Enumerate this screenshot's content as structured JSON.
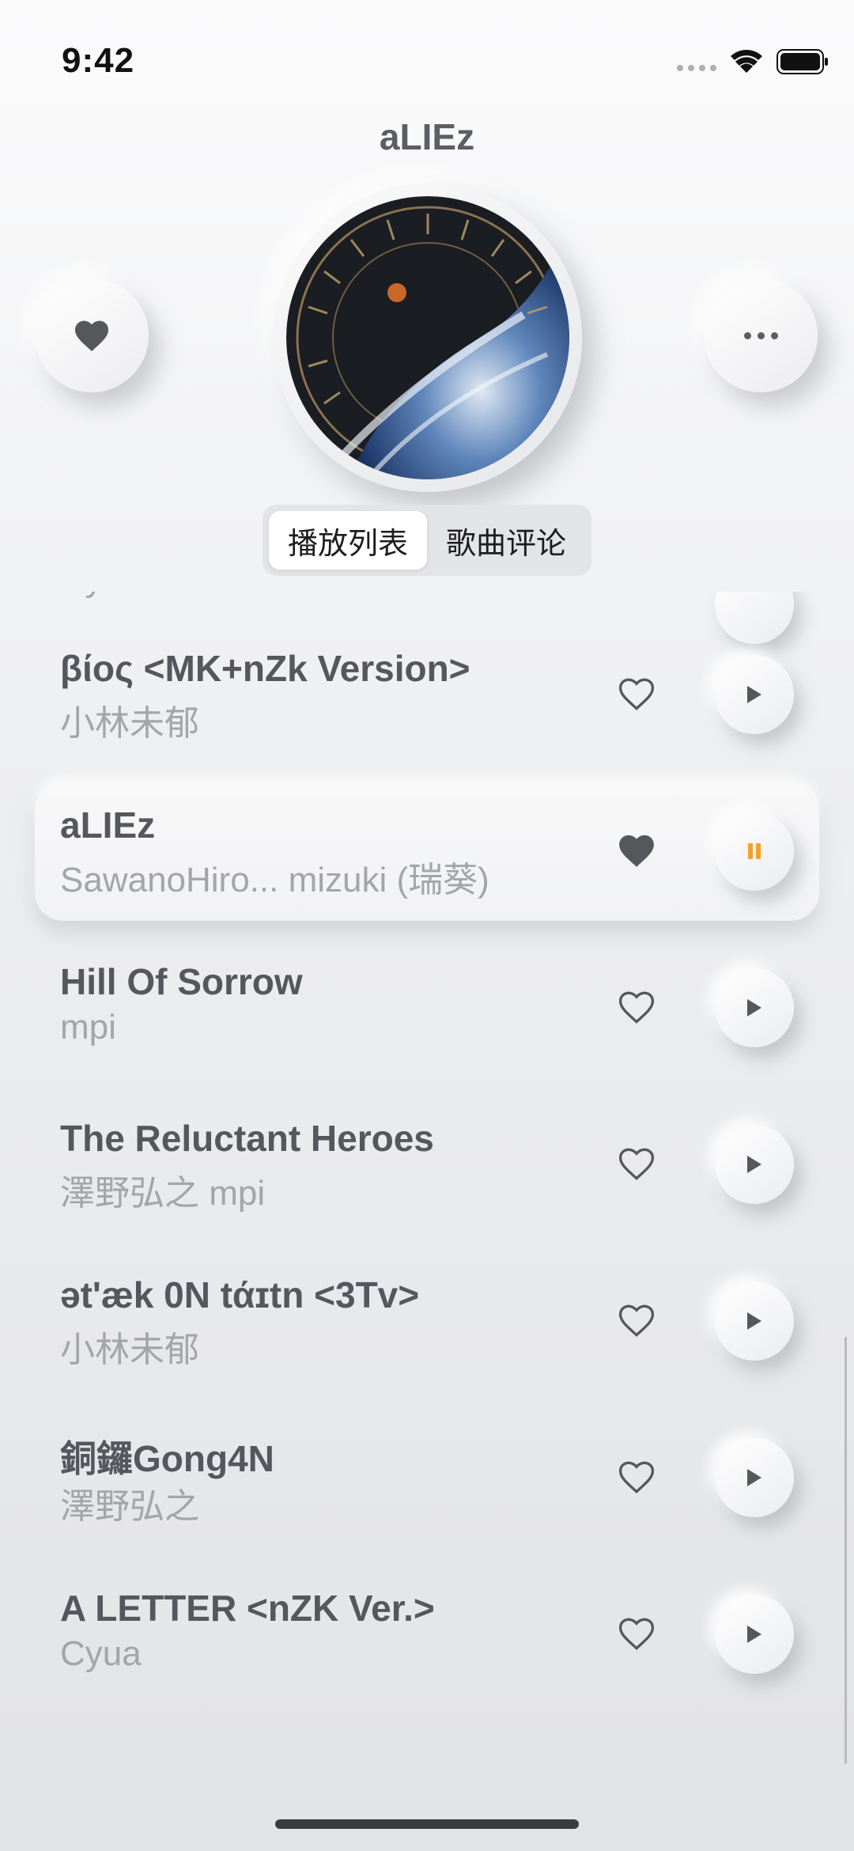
{
  "status_bar": {
    "time": "9:42"
  },
  "header": {
    "title": "aLIEz"
  },
  "segmented": {
    "tabs": [
      "播放列表",
      "歌曲评论"
    ],
    "active": 0
  },
  "playlist": {
    "partial_top_artist": "Cyua",
    "songs": [
      {
        "title": "βίος <MK+nZk Version>",
        "artist": "小林未郁",
        "liked": false,
        "playing": false
      },
      {
        "title": "aLIEz",
        "artist": "SawanoHiro...  mizuki (瑞葵)",
        "liked": true,
        "playing": true
      },
      {
        "title": "Hill Of Sorrow",
        "artist": "mpi",
        "liked": false,
        "playing": false
      },
      {
        "title": "The Reluctant Heroes",
        "artist": "澤野弘之  mpi",
        "liked": false,
        "playing": false
      },
      {
        "title": "ət'æk 0N tάɪtn <3Tv>",
        "artist": "小林未郁",
        "liked": false,
        "playing": false
      },
      {
        "title": "銅鑼Gong4N",
        "artist": "澤野弘之",
        "liked": false,
        "playing": false
      },
      {
        "title": "A LETTER <nZK Ver.>",
        "artist": "Cyua",
        "liked": false,
        "playing": false
      }
    ]
  },
  "colors": {
    "accent_pause": "#f2a22c",
    "icon": "#55575c"
  }
}
